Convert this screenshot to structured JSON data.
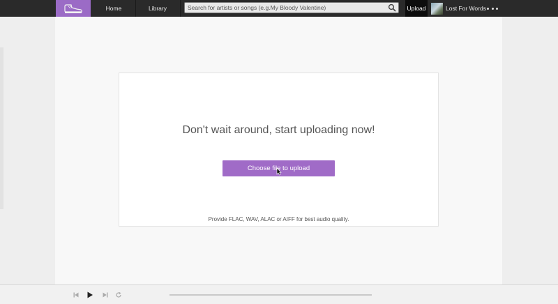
{
  "nav": {
    "logo_icon": "sneaker-icon",
    "home": "Home",
    "library": "Library",
    "search_placeholder": "Search for artists or songs (e.g.My Bloody Valentine)",
    "upload": "Upload",
    "username": "Lost For Words",
    "more_icon": "more-dots-icon"
  },
  "upload_card": {
    "headline": "Don't wait around, start uploading now!",
    "button_label": "Choose file to upload",
    "hint": "Provide FLAC, WAV, ALAC or AIFF for best audio quality."
  },
  "player": {
    "prev_icon": "skip-back-icon",
    "play_icon": "play-icon",
    "next_icon": "skip-forward-icon",
    "repeat_icon": "repeat-icon"
  },
  "colors": {
    "accent": "#a06bc7",
    "topbar": "#2a2a2a"
  }
}
